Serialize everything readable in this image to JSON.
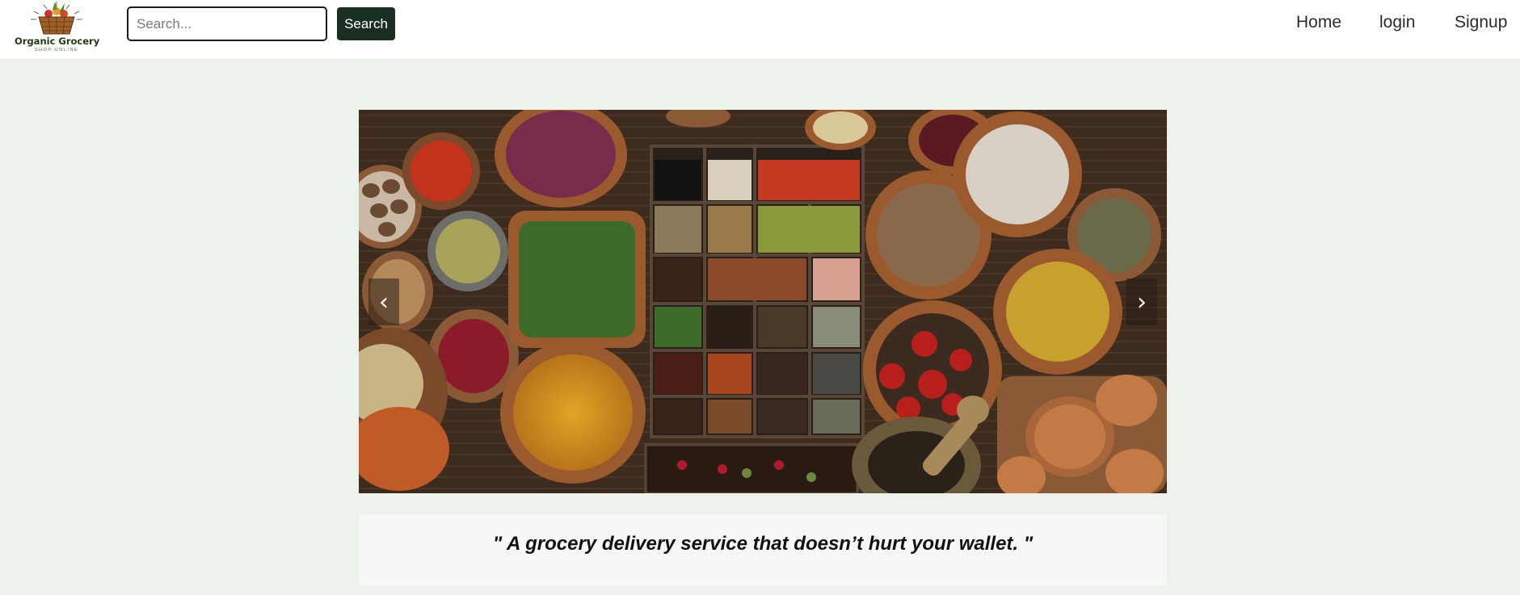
{
  "brand": {
    "name": "Organic Grocery",
    "tagline": "SHOP ONLINE"
  },
  "search": {
    "placeholder": "Search...",
    "value": "",
    "button_label": "Search"
  },
  "nav": {
    "links": [
      {
        "label": "Home"
      },
      {
        "label": "login"
      },
      {
        "label": "Signup"
      }
    ]
  },
  "carousel": {
    "prev_icon": "‹",
    "next_icon": "›",
    "slide_image": "spices-in-wooden-bowls"
  },
  "quote": {
    "text": "\" A grocery delivery service that doesn’t hurt your wallet. \""
  },
  "colors": {
    "background": "#edf2ed",
    "navbar": "#ffffff",
    "search_button": "#1a2e24",
    "quote_box": "#f7f7f7"
  }
}
